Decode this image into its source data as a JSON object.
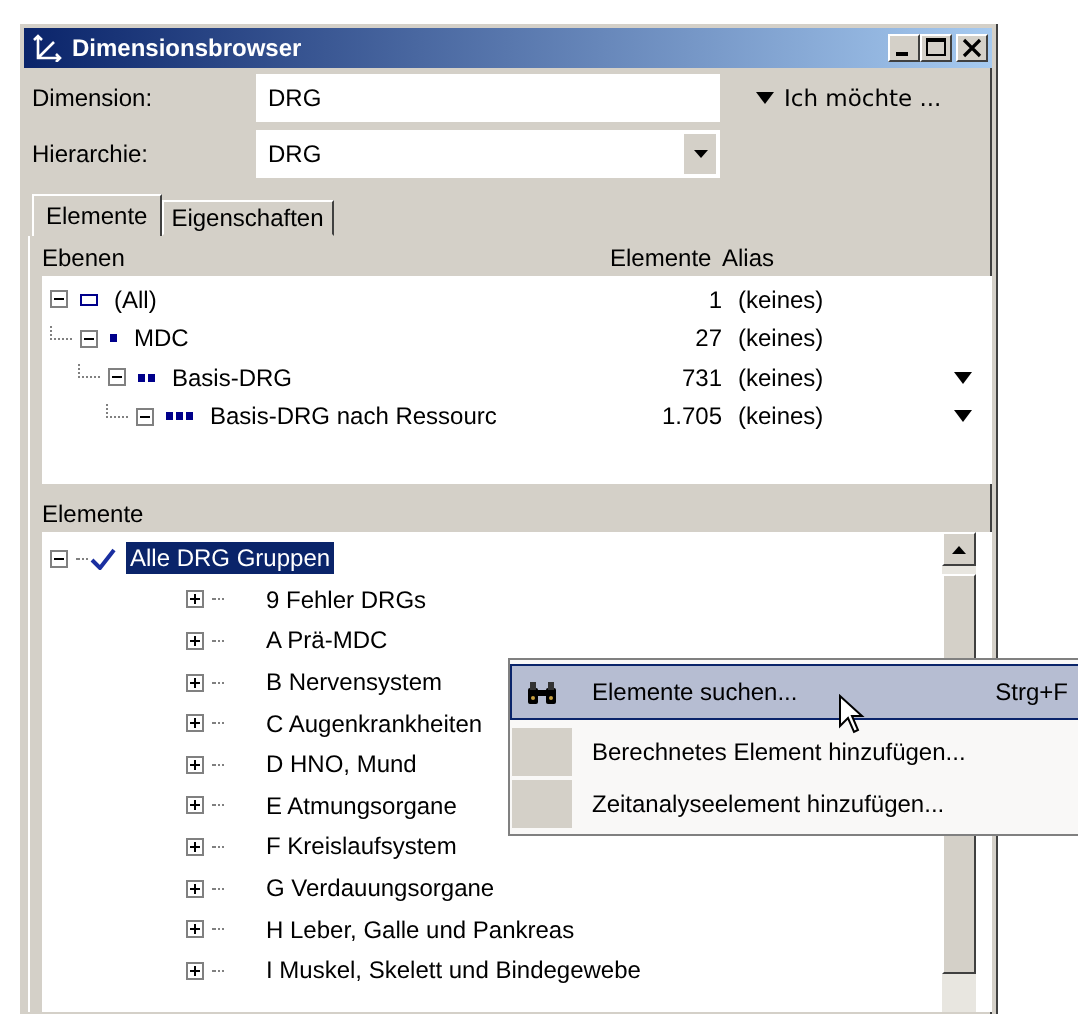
{
  "window": {
    "title": "Dimensionsbrowser"
  },
  "fields": [
    {
      "label": "Dimension:",
      "value": "DRG",
      "kind": "text"
    },
    {
      "label": "Hierarchie:",
      "value": "DRG",
      "kind": "dropdown"
    }
  ],
  "action_link": "Ich möchte ...",
  "tabs": [
    {
      "label": "Elemente",
      "selected": true
    },
    {
      "label": "Eigenschaften",
      "selected": false
    }
  ],
  "levels": {
    "title": "Ebenen",
    "columns": [
      "Elemente",
      "Alias"
    ],
    "rows": [
      {
        "name": "(All)",
        "expanded": true,
        "count": "1",
        "alias": "(keines)",
        "dropdown": false,
        "children": [
          {
            "name": "MDC",
            "expanded": true,
            "count": "27",
            "alias": "(keines)",
            "dropdown": false,
            "children": [
              {
                "name": "Basis-DRG",
                "expanded": true,
                "count": "731",
                "alias": "(keines)",
                "dropdown": true,
                "children": [
                  {
                    "name": "Basis-DRG nach Ressourc",
                    "expanded": true,
                    "count": "1.705",
                    "alias": "(keines)",
                    "dropdown": true
                  }
                ]
              }
            ]
          }
        ]
      }
    ]
  },
  "elements": {
    "title": "Elemente",
    "rows": [
      {
        "name": "Alle DRG Gruppen",
        "expanded": true,
        "checked": true,
        "selected": true,
        "children": [
          {
            "name": "9 Fehler DRGs",
            "expanded": false,
            "checked": false,
            "selected": false
          },
          {
            "name": "A Prä-MDC",
            "expanded": false,
            "checked": false,
            "selected": false
          },
          {
            "name": "B Nervensystem",
            "expanded": false,
            "checked": false,
            "selected": false
          },
          {
            "name": "C Augenkrankheiten",
            "expanded": false,
            "checked": false,
            "selected": false
          },
          {
            "name": "D HNO, Mund",
            "expanded": false,
            "checked": false,
            "selected": false
          },
          {
            "name": "E Atmungsorgane",
            "expanded": false,
            "checked": false,
            "selected": false
          },
          {
            "name": "F Kreislaufsystem",
            "expanded": false,
            "checked": false,
            "selected": false
          },
          {
            "name": "G Verdauungsorgane",
            "expanded": false,
            "checked": false,
            "selected": false
          },
          {
            "name": "H Leber, Galle und Pankreas",
            "expanded": false,
            "checked": false,
            "selected": false
          },
          {
            "name": "I Muskel, Skelett und Bindegewebe",
            "expanded": false,
            "checked": false,
            "selected": false
          }
        ]
      }
    ]
  },
  "context_menu": [
    {
      "label": "Elemente suchen...",
      "shortcut": "Strg+F",
      "kind": "search",
      "selected": true
    },
    {
      "label": "Berechnetes Element hinzufügen...",
      "kind": "plain",
      "selected": false
    },
    {
      "label": "Zeitanalyseelement hinzufügen...",
      "kind": "plain",
      "selected": false
    }
  ]
}
